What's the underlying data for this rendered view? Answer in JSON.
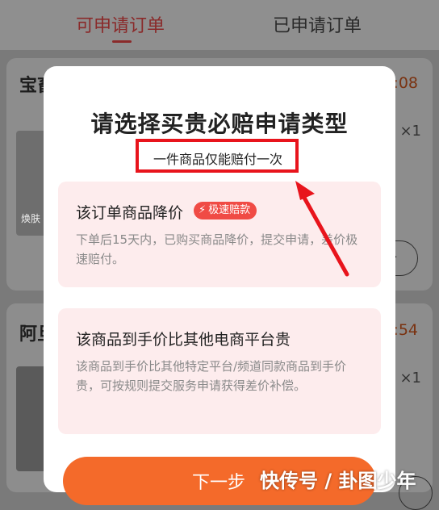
{
  "tabs": {
    "active": "可申请订单",
    "inactive": "已申请订单"
  },
  "background": {
    "order1": {
      "title_fragment": "宝畜",
      "time_fragment": "3:08",
      "quantity": "×1",
      "product_tag": "焕肤",
      "button_fragment": "付"
    },
    "order2": {
      "title_fragment": "阿旦",
      "time_fragment": "0:54",
      "quantity": "×1"
    }
  },
  "modal": {
    "title": "请选择买贵必赔申请类型",
    "subtitle": "一件商品仅能赔付一次",
    "options": [
      {
        "title": "该订单商品降价",
        "badge": "极速赔款",
        "description": "下单后15天内，已购买商品降价，提交申请，差价极速赔付。"
      },
      {
        "title": "该商品到手价比其他电商平台贵",
        "description": "该商品到手价比其他特定平台/频道同款商品到手价贵，可按规则提交服务申请获得差价补偿。"
      }
    ],
    "next_button": "下一步"
  },
  "watermark": "快传号 / 卦图少年",
  "colors": {
    "accent": "#e8141c",
    "option_bg": "#fdeced",
    "badge": "#f04b45",
    "button": "#f46a2a"
  },
  "icons": [
    "bolt-icon",
    "arrow-annotation"
  ]
}
